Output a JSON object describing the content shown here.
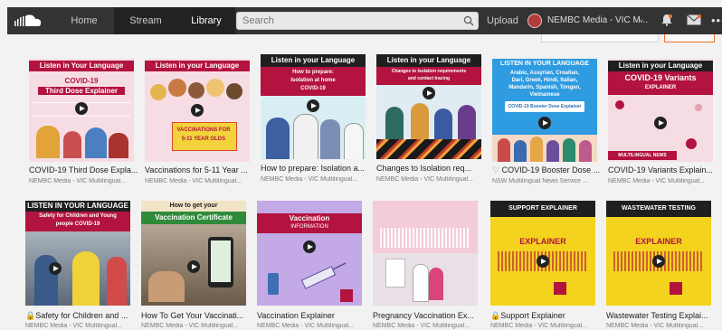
{
  "nav": {
    "home": "Home",
    "stream": "Stream",
    "library": "Library",
    "search_placeholder": "Search",
    "upload": "Upload",
    "username": "NEMBC Media - VIC M..."
  },
  "row1": [
    {
      "title": "COVID-19 Third Dose Expla...",
      "sub": "NEMBC Media - VIC Multilingual...",
      "banner": "Listen in Your Language",
      "line1": "COVID-19",
      "line2": "Third Dose Explainer"
    },
    {
      "title": "Vaccinations for 5-11 Year ...",
      "sub": "NEMBC Media - VIC Multilingual...",
      "banner": "Listen in your Language",
      "line1": "VACCINATIONS FOR",
      "line2": "5-11 YEAR OLDS"
    },
    {
      "title": "How to prepare: Isolation a...",
      "sub": "NEMBC Media - VIC Multilingual...",
      "banner": "Listen in your Language",
      "line1": "How to prepare:",
      "line2": "Isolation at home",
      "line3": "COVID-19"
    },
    {
      "title": "Changes to Isolation req...",
      "sub": "NEMBC Media - VIC Multilingual...",
      "banner": "Listen in your Language",
      "line1": "Changes to Isolation requirements",
      "line2": "and contact tracing"
    },
    {
      "title": "COVID-19 Booster Dose ...",
      "sub": "NSW Multilingual News Service ...",
      "banner": "LISTEN IN YOUR LANGUAGE",
      "line1": "Arabic, Assyrian, Croatian,",
      "line2": "Dari, Greek, Hindi, Italian,",
      "line3": "Mandarin, Spanish, Tongan,",
      "line4": "Vietnamese",
      "tag": "COVID-19 Booster Dose Explainer"
    },
    {
      "title": "COVID-19 Variants Explain...",
      "sub": "NEMBC Media - VIC Multilingual...",
      "banner": "Listen in your Language",
      "line1": "COVID-19 Variants",
      "line2": "EXPLAINER",
      "tag": "MULTILINGUAL NEWS SERVICE"
    }
  ],
  "row2": [
    {
      "title": "Safety for Children and ...",
      "sub": "NEMBC Media - VIC Multilingual...",
      "banner": "LISTEN IN YOUR LANGUAGE",
      "line1": "Safety for Children and Young",
      "line2": "people COVID-19"
    },
    {
      "title": "How To Get Your Vaccinati...",
      "sub": "NEMBC Media - VIC Multilingual...",
      "line1": "How to get your",
      "line2": "Vaccination Certificate"
    },
    {
      "title": "Vaccination Explainer",
      "sub": "NEMBC Media - VIC Multilingual...",
      "line1": "Vaccination",
      "line2": "INFORMATION"
    },
    {
      "title": "Pregnancy Vaccination Ex...",
      "sub": "NEMBC Media - VIC Multilingual..."
    },
    {
      "title": "Support Explainer",
      "sub": "NEMBC Media - VIC Multilingual...",
      "banner": "SUPPORT EXPLAINER",
      "line1": "EXPLAINER"
    },
    {
      "title": "Wastewater Testing Explai...",
      "sub": "NEMBC Media - VIC Multilingual...",
      "banner": "WASTEWATER TESTING",
      "line1": "EXPLAINER"
    }
  ]
}
